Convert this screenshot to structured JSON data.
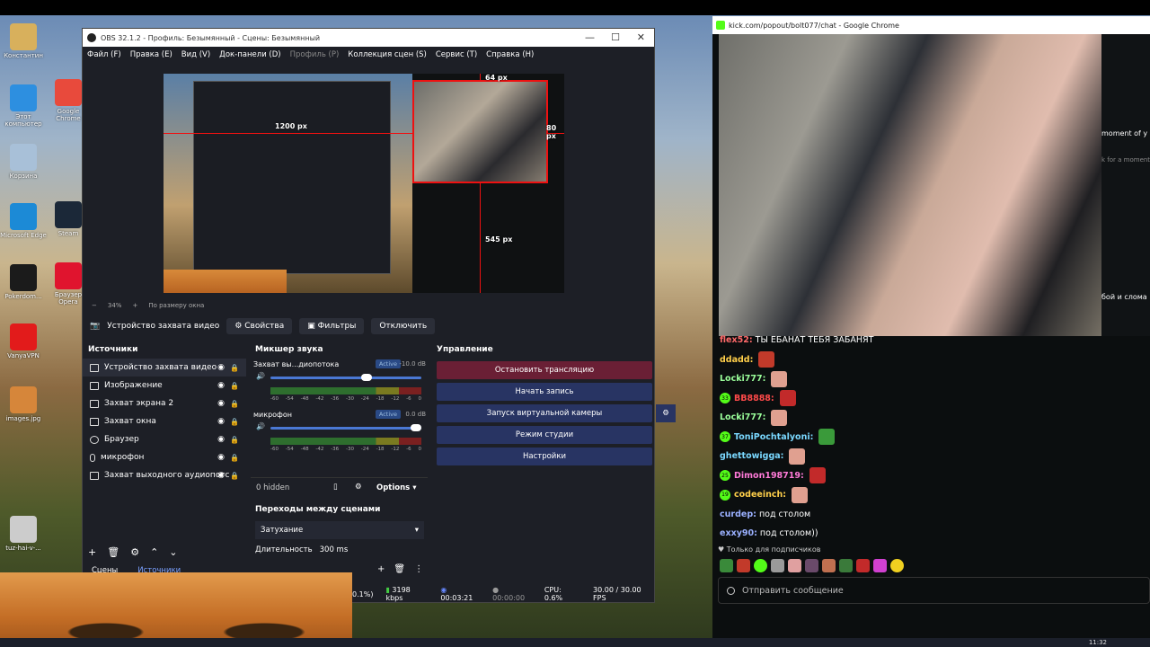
{
  "desktop": {
    "icons": [
      {
        "label": "Константин",
        "color": "#d8b05c"
      },
      {
        "label": "Этот компьютер",
        "color": "#2d8fe0"
      },
      {
        "label": "Корзина",
        "color": "#a8c0d8"
      },
      {
        "label": "Microsoft Edge",
        "color": "#1c8ad6"
      },
      {
        "label": "Pokerdom...",
        "color": "#1b1b1b"
      },
      {
        "label": "VanyaVPN",
        "color": "#e21b1b"
      },
      {
        "label": "images.jpg",
        "color": "#d6863a"
      },
      {
        "label": "tuz-hai-v-...",
        "color": "#ccc"
      },
      {
        "label": "Google Chrome",
        "color": "#e84a3c"
      },
      {
        "label": "Steam",
        "color": "#1b2838"
      },
      {
        "label": "Браузер Opera",
        "color": "#e0142e"
      }
    ]
  },
  "obs": {
    "title": "OBS 32.1.2 - Профиль: Безымянный - Сцены: Безымянный",
    "menu": [
      "Файл (F)",
      "Правка (E)",
      "Вид (V)",
      "Док-панели (D)",
      "Профиль (P)",
      "Коллекция сцен (S)",
      "Сервис (T)",
      "Справка (H)"
    ],
    "preview": {
      "labels": [
        "1200 px",
        "64 px",
        "80 px",
        "545 px"
      ],
      "zoom": "34%",
      "fit": "По размеру окна"
    },
    "source_bar": {
      "source_name": "Устройство захвата видео",
      "properties": "Свойства",
      "filters": "Фильтры",
      "deactivate": "Отключить"
    },
    "sources": {
      "title": "Источники",
      "items": [
        {
          "label": "Устройство захвата видео",
          "icon": "camera-icon"
        },
        {
          "label": "Изображение",
          "icon": "image-icon"
        },
        {
          "label": "Захват экрана 2",
          "icon": "monitor-icon"
        },
        {
          "label": "Захват окна",
          "icon": "window-icon"
        },
        {
          "label": "Браузер",
          "icon": "globe-icon"
        },
        {
          "label": "микрофон",
          "icon": "mic-icon"
        },
        {
          "label": "Захват выходного аудиопотс",
          "icon": "speaker-icon"
        }
      ],
      "tabs": [
        "Сцены",
        "Источники"
      ]
    },
    "mixer": {
      "title": "Микшер звука",
      "channels": [
        {
          "name": "Захват вы...диопотока",
          "status": "Active",
          "db": "-10.0 dB",
          "level": 0.65
        },
        {
          "name": "микрофон",
          "status": "Active",
          "db": "0.0 dB",
          "level": 1.0
        }
      ],
      "scale": [
        "-60",
        "-54",
        "-48",
        "-42",
        "-36",
        "-30",
        "-24",
        "-18",
        "-12",
        "-6",
        "0"
      ],
      "hidden": "0 hidden",
      "options": "Options"
    },
    "transitions": {
      "title": "Переходы между сценами",
      "type": "Затухание",
      "duration_label": "Длительность",
      "duration": "300 ms"
    },
    "control": {
      "title": "Управление",
      "buttons": [
        "Остановить трансляцию",
        "Начать запись",
        "Запуск виртуальной камеры",
        "Режим студии",
        "Настройки"
      ]
    },
    "status": {
      "drop": "0.1%)",
      "bitrate": "3198 kbps",
      "stream_time": "00:03:21",
      "rec_time": "00:00:00",
      "cpu": "CPU: 0.6%",
      "fps": "30.00 / 30.00 FPS"
    }
  },
  "chrome": {
    "title": "kick.com/popout/bolt077/chat - Google Chrome",
    "side_snippets": [
      "moment of y",
      "k for a moment",
      "бой и слома"
    ],
    "messages": [
      {
        "user": "flex52",
        "color": "#ff6a6a",
        "text": "ТЫ ЕБАНАТ ТЕБЯ ЗАБАНЯТ",
        "badge": "",
        "emote": ""
      },
      {
        "user": "ddadd",
        "color": "#ffcf4a",
        "text": "",
        "badge": "",
        "emote": "#c23a2a"
      },
      {
        "user": "Locki777",
        "color": "#9bff9b",
        "text": "",
        "badge": "",
        "emote": "#e0a090"
      },
      {
        "user": "BB8888",
        "color": "#ff4a4a",
        "text": "",
        "badge": "33",
        "emote": "#c22a2a"
      },
      {
        "user": "Locki777",
        "color": "#9bff9b",
        "text": "",
        "badge": "",
        "emote": "#e0a090"
      },
      {
        "user": "ToniPochtalyoni",
        "color": "#7ad8ff",
        "text": "",
        "badge": "37",
        "emote": "#3a9a3a"
      },
      {
        "user": "ghettowigga",
        "color": "#7ad8ff",
        "text": "",
        "badge": "",
        "emote": "#e0a090"
      },
      {
        "user": "Dimon198719",
        "color": "#ff7ad8",
        "text": "",
        "badge": "25",
        "emote": "#c22a2a"
      },
      {
        "user": "codeeinch",
        "color": "#ffcf4a",
        "text": "",
        "badge": "19",
        "emote": "#e0a090"
      },
      {
        "user": "curdep",
        "color": "#9ab0ff",
        "text": "под столом",
        "badge": "",
        "emote": ""
      },
      {
        "user": "exxy90",
        "color": "#9ab0ff",
        "text": "под столом))",
        "badge": "",
        "emote": ""
      }
    ],
    "subs_only": "Только для подписчиков",
    "input_placeholder": "Отправить сообщение"
  },
  "taskbar": {
    "clock": "11:32"
  }
}
